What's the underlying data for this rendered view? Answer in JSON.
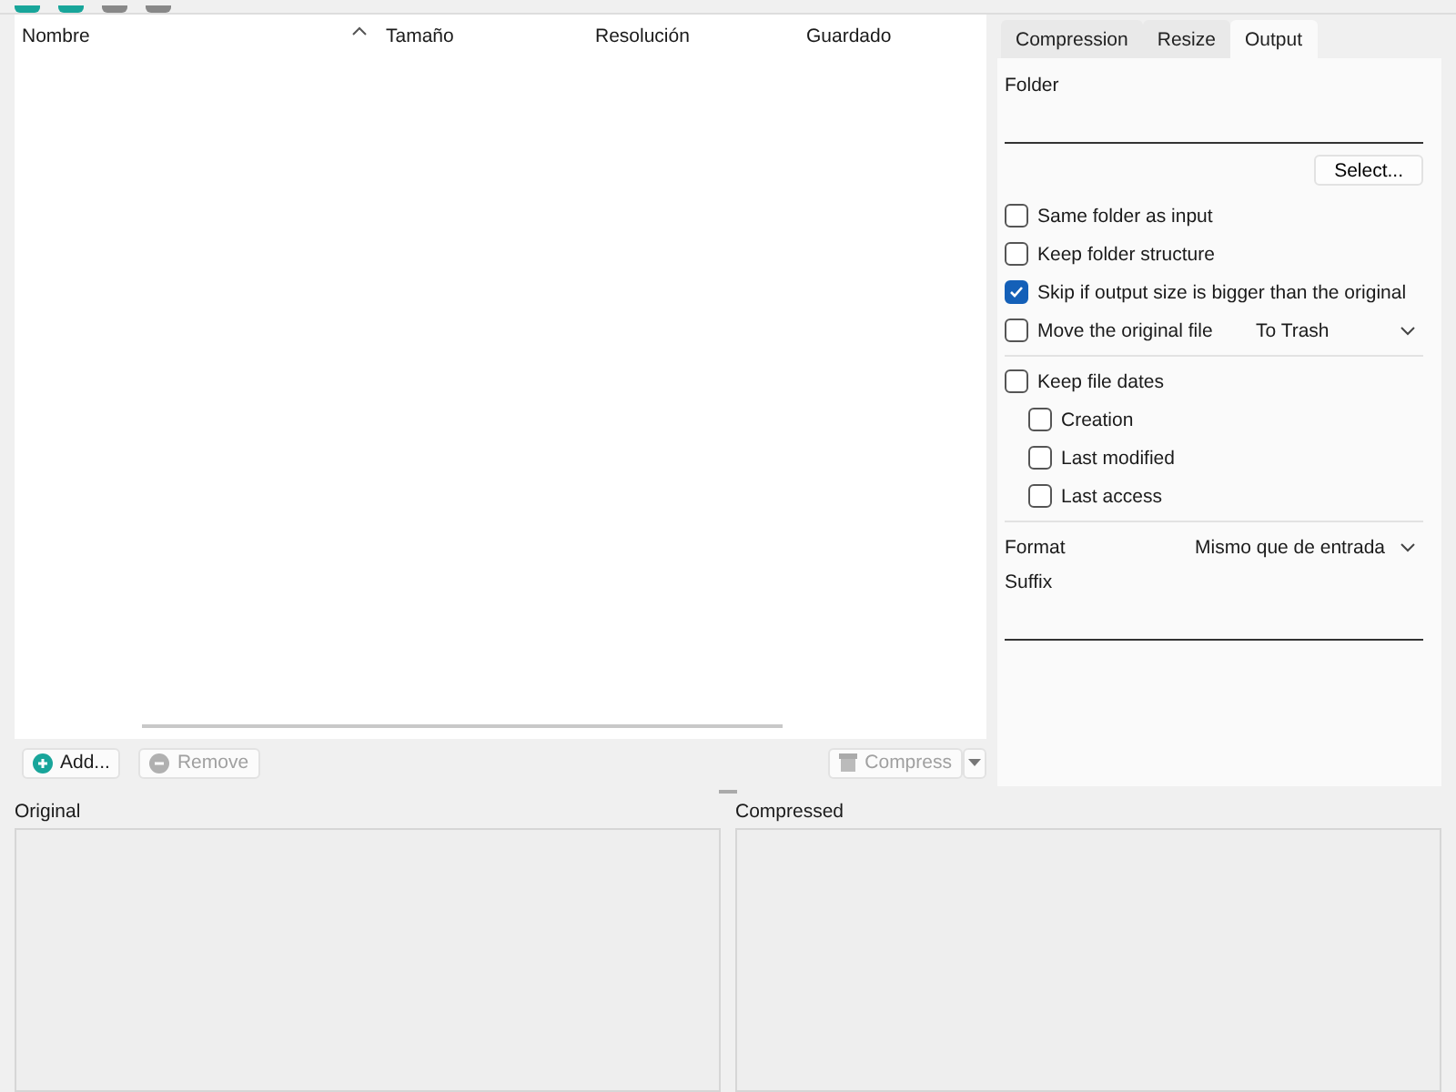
{
  "table": {
    "columns": [
      {
        "label": "Nombre",
        "sorted": true
      },
      {
        "label": "Tamaño",
        "sorted": false
      },
      {
        "label": "Resolución",
        "sorted": false
      },
      {
        "label": "Guardado",
        "sorted": false
      }
    ]
  },
  "buttons": [
    {
      "kind": "add",
      "label": "Add...",
      "disabled": false
    },
    {
      "kind": "remove",
      "label": "Remove",
      "disabled": true
    }
  ],
  "compress": {
    "label": "Compress",
    "disabled": true
  },
  "tabs": [
    {
      "label": "Compression",
      "selected": false
    },
    {
      "label": "Resize",
      "selected": false
    },
    {
      "label": "Output",
      "selected": true
    }
  ],
  "output": {
    "folder_label": "Folder",
    "select_button": "Select...",
    "options": [
      {
        "label": "Same folder as input",
        "checked": false
      },
      {
        "label": "Keep folder structure",
        "checked": false
      },
      {
        "label": "Skip if output size is bigger than the original",
        "checked": true
      },
      {
        "label": "Move the original file",
        "checked": false,
        "dropdown": "To Trash"
      }
    ],
    "dates": {
      "label": "Keep file dates",
      "checked": false,
      "children": [
        {
          "label": "Creation",
          "checked": false
        },
        {
          "label": "Last modified",
          "checked": false
        },
        {
          "label": "Last access",
          "checked": false
        }
      ]
    },
    "format_label": "Format",
    "format_value": "Mismo que de entrada",
    "suffix_label": "Suffix"
  },
  "previews": [
    {
      "label": "Original"
    },
    {
      "label": "Compressed"
    }
  ]
}
